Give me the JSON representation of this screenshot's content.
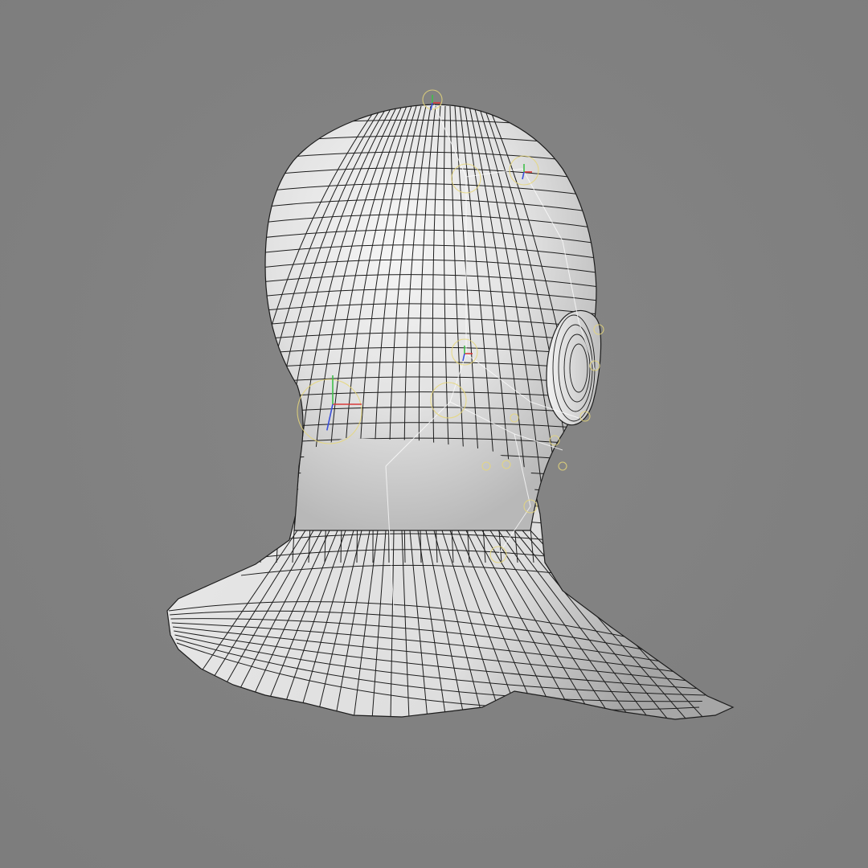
{
  "viewport": {
    "background": "#7d7d7d",
    "background_light": "#868686",
    "mesh_fill": "#eeeeee",
    "mesh_shadow": "#a9a9a9",
    "wire_color": "#1c1c1c",
    "rig_color": "#ffffff",
    "control_color": "#e6d77a",
    "axis_x_color": "#d93a3a",
    "axis_y_color": "#3fbf4a",
    "axis_z_color": "#3a4fd9"
  },
  "mesh": {
    "icon": "head-mesh-wireframe"
  },
  "rig": {
    "icon": "facial-rig-controls"
  }
}
